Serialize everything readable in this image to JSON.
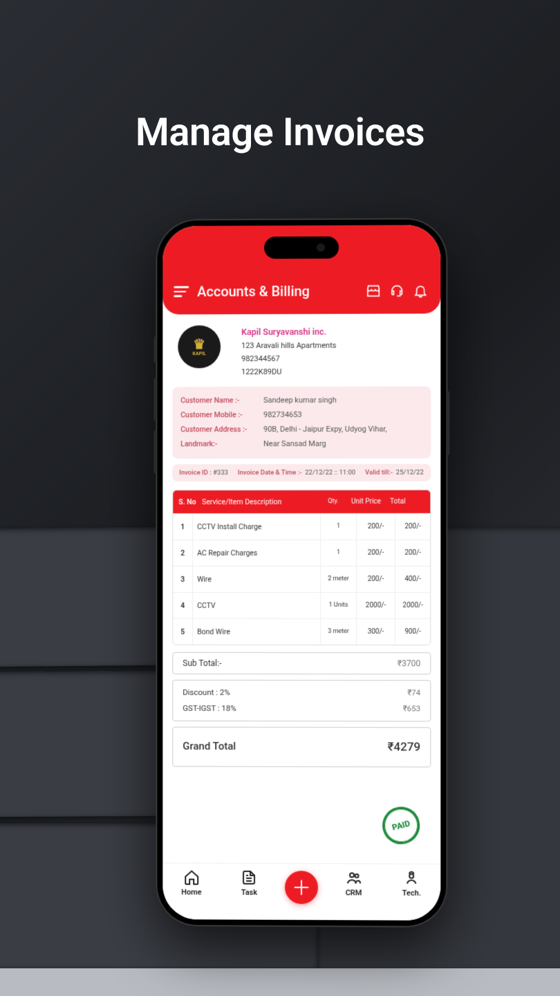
{
  "promo_heading": "Manage Invoices",
  "header": {
    "title": "Accounts & Billing"
  },
  "company": {
    "logo_text": "KAPIL",
    "name": "Kapil Suryavanshi inc.",
    "address": "123 Aravali hills Apartments",
    "mobile": "982344567",
    "code": "1222K89DU"
  },
  "customer": {
    "name_label": "Customer Name :-",
    "name": "Sandeep kumar singh",
    "mobile_label": "Customer Mobile :-",
    "mobile": "982734653",
    "address_label": "Customer Address :-",
    "address": "90B, Delhi - Jaipur Expy, Udyog Vihar,",
    "landmark_label": "Landmark:-",
    "landmark": "Near Sansad Marg"
  },
  "invoice_meta": {
    "id_label": "Invoice ID :",
    "id": "#333",
    "date_label": "Invoice Date & Time :-",
    "date": "22/12/22 :: 11:00",
    "valid_label": "Valid till:-",
    "valid": "25/12/22"
  },
  "table": {
    "headers": {
      "sno": "S. No",
      "desc": "Service/Item Description",
      "qty": "Qty.",
      "up": "Unit Price",
      "total": "Total"
    },
    "rows": [
      {
        "sno": "1",
        "desc": "CCTV Install Charge",
        "qty": "1",
        "up": "200/-",
        "total": "200/-"
      },
      {
        "sno": "2",
        "desc": "AC Repair Charges",
        "qty": "1",
        "up": "200/-",
        "total": "200/-"
      },
      {
        "sno": "3",
        "desc": "Wire",
        "qty": "2  meter",
        "up": "200/-",
        "total": "400/-"
      },
      {
        "sno": "4",
        "desc": "CCTV",
        "qty": "1  Units",
        "up": "2000/-",
        "total": "2000/-"
      },
      {
        "sno": "5",
        "desc": "Bond Wire",
        "qty": "3  meter",
        "up": "300/-",
        "total": "900/-"
      }
    ]
  },
  "totals": {
    "subtotal_label": "Sub Total:-",
    "subtotal": "₹3700",
    "discount_label": "Discount : 2%",
    "discount": "₹74",
    "gst_label": "GST-IGST : 18%",
    "gst": "₹653",
    "grand_label": "Grand Total",
    "grand": "₹4279"
  },
  "stamp": "PAID",
  "nav": {
    "home": "Home",
    "task": "Task",
    "crm": "CRM",
    "tech": "Tech."
  }
}
